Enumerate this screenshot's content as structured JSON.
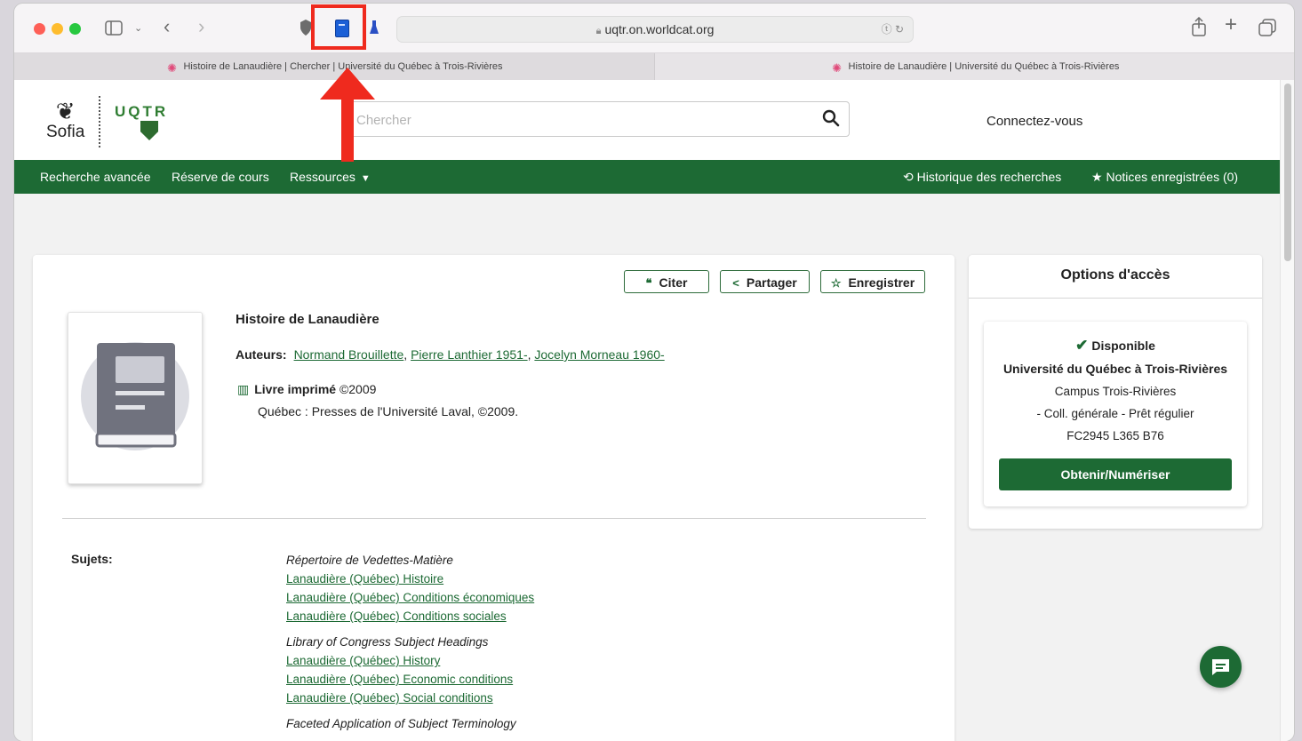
{
  "browser": {
    "url": "uqtr.on.worldcat.org",
    "tabs": [
      {
        "label": "Histoire de Lanaudière | Chercher | Université du Québec à Trois-Rivières",
        "active": true
      },
      {
        "label": "Histoire de Lanaudière | Université du Québec à Trois-Rivières",
        "active": false
      }
    ]
  },
  "header": {
    "sofia_label": "Sofia",
    "uqtr_label": "UQTR",
    "search_placeholder": "Chercher",
    "login_label": "Connectez-vous"
  },
  "nav": {
    "advanced_search": "Recherche avancée",
    "course_reserve": "Réserve de cours",
    "resources": "Ressources",
    "search_history": "Historique des recherches",
    "saved_records": "Notices enregistrées (0)"
  },
  "record": {
    "actions": {
      "cite": "Citer",
      "share": "Partager",
      "save": "Enregistrer"
    },
    "title": "Histoire de Lanaudière",
    "authors_label": "Auteurs:",
    "authors": [
      "Normand Brouillette",
      "Pierre Lanthier 1951-",
      "Jocelyn Morneau 1960-"
    ],
    "format_label": "Livre imprimé",
    "format_year": "©2009",
    "publisher": "Québec : Presses de l'Université Laval, ©2009.",
    "subjects_label": "Sujets:",
    "subject_groups": [
      {
        "heading": "Répertoire de Vedettes-Matière",
        "items": [
          "Lanaudière (Québec) Histoire",
          "Lanaudière (Québec) Conditions économiques",
          "Lanaudière (Québec) Conditions sociales"
        ]
      },
      {
        "heading": "Library of Congress Subject Headings",
        "items": [
          "Lanaudière (Québec) History",
          "Lanaudière (Québec) Economic conditions",
          "Lanaudière (Québec) Social conditions"
        ]
      },
      {
        "heading": "Faceted Application of Subject Terminology",
        "items": []
      }
    ]
  },
  "access": {
    "title": "Options d'accès",
    "status": "Disponible",
    "institution": "Université du Québec à Trois-Rivières",
    "campus": "Campus Trois-Rivières",
    "collection": "- Coll. générale - Prêt régulier",
    "call_number": "FC2945 L365 B76",
    "button": "Obtenir/Numériser"
  },
  "colors": {
    "brand_green": "#1d6a34",
    "annotation_red": "#ef2a1e"
  }
}
